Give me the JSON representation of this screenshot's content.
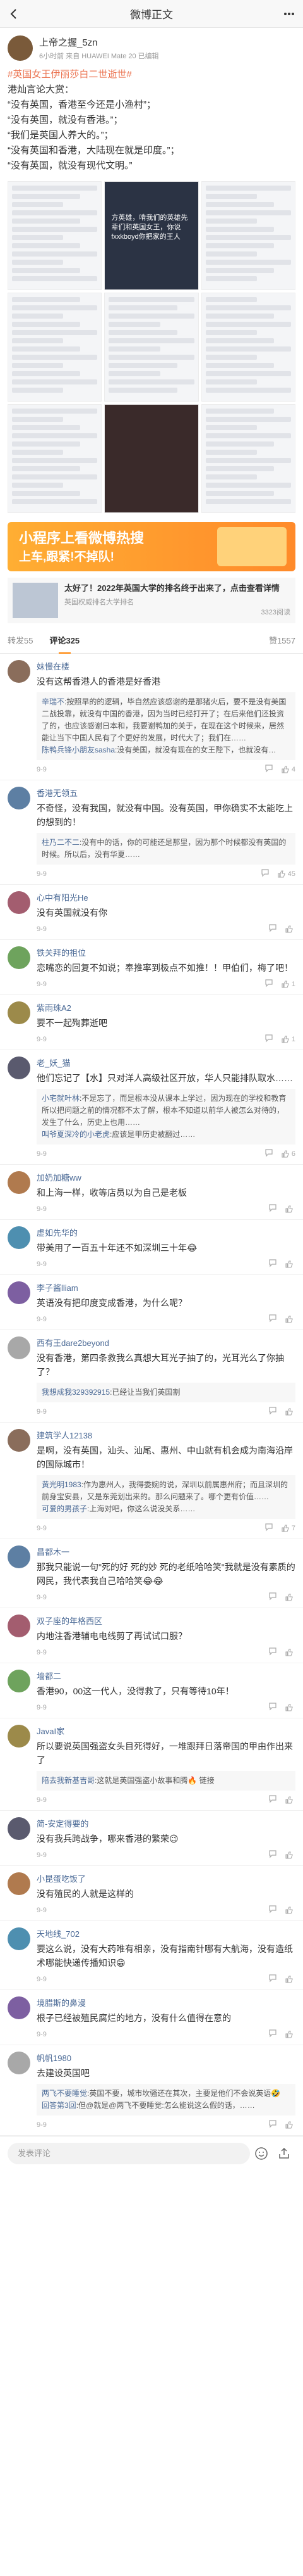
{
  "topbar": {
    "title": "微博正文"
  },
  "post": {
    "author": "上帝之握_5zn",
    "meta": "6小时前 来自 HUAWEI Mate 20 已编辑",
    "tag": "#英国女王伊丽莎白二世逝世#",
    "lines": [
      "港灿言论大赏：",
      "“没有英国，香港至今还是小渔村”；",
      "“没有英国，就没有香港。”；",
      "“我们是英国人养大的。”；",
      "“没有英国和香港，大陆现在就是印度。”；",
      "“没有英国，就没有现代文明。”"
    ],
    "image_caption": "方英雄，啃我们的英雄先辈们和英国女王，你说fxxkboyd你把家的王人"
  },
  "banner": {
    "line1": "小程序上看微博热搜",
    "line2": "上车,跟紧!不掉队!"
  },
  "card": {
    "title": "太好了！2022年英国大学的排名终于出来了，点击查看详情",
    "sub": "英国权威排名大学排名",
    "reads": "3323阅读"
  },
  "tabs": {
    "share": "转发55",
    "comments": "评论325",
    "likes": "赞1557"
  },
  "comments": [
    {
      "name": "妹慢在楼",
      "text": "没有这帮香港人的香港是好香港",
      "reply": {
        "who": "辛瑞不",
        "text": ":按照早的的逻辑，毕自然应该感谢的是那猪火后，要不是没有美国二战投靠，就没有中国的香港，因为当时已经打开了；在后来他们还投资了的，也应该感谢日本和，我要谢鸭加的关于，在现在这个时候来，居然能让当下中国人民有了个更好的发展，时代大了；我们在……",
        "who2": "陈鸭兵锋小朋友sasha",
        "text2": ":没有美国，就没有现在的女王陛下，也就没有…"
      },
      "date": "9-9",
      "likes": "4"
    },
    {
      "name": "香港无领五",
      "text": "不奇怪，没有我国，就没有中国。没有英国，甲你确实不太能吃上的想到的！",
      "reply": {
        "who": "柱乃二不二",
        "text": ":没有中的话，你的可能还是那里，因为那个时候都没有英国的时候。所以后，没有华夏……",
        "who2": "",
        "text2": ""
      },
      "date": "9-9",
      "likes": "45"
    },
    {
      "name": "心中有阳光He",
      "text": "没有英国就没有你",
      "reply": null,
      "date": "9-9",
      "likes": ""
    },
    {
      "name": "铁关拜的祖位",
      "text": "恋嘴恋的回复不如说；奉推率到极点不如推！！甲伯们，梅了吧！",
      "reply": null,
      "date": "9-9",
      "likes": "1"
    },
    {
      "name": "紫雨珠A2",
      "text": "要不一起殉葬逝吧",
      "reply": null,
      "date": "9-9",
      "likes": "1"
    },
    {
      "name": "老_妖_猫",
      "text": "他们忘记了【水】只对洋人高级社区开放，华人只能排队取水……",
      "reply": {
        "who": "小宅就叶林",
        "text": ":不是忘了，而是根本没从课本上学过，因为现在的学校和教育所以把问题之前的情况都不太了解，根本不知道以前华人被怎么对待的，发生了什么，历史上也用……",
        "who2": "叫爷夏深冷的小老虎",
        "text2": ":应该是甲历史被翻过……"
      },
      "date": "9-9",
      "likes": "6"
    },
    {
      "name": "加奶加糖ww",
      "text": "和上海一样，收等店员以为自己是老板",
      "reply": null,
      "date": "9-9",
      "likes": ""
    },
    {
      "name": "虚如先华的",
      "text": "带美用了一百五十年还不如深圳三十年😂",
      "reply": null,
      "date": "9-9",
      "likes": ""
    },
    {
      "name": "李子酱lliam",
      "text": "英语没有把印度变成香港，为什么呢？",
      "reply": null,
      "date": "9-9",
      "likes": ""
    },
    {
      "name": "西有王dare2beyond",
      "text": "没有香港，第四条救我么真想大耳光子抽了的，光耳光么了你抽了？",
      "reply": {
        "who": "我想成我329392915",
        "text": ":已经让当我们英国割",
        "who2": "",
        "text2": ""
      },
      "date": "9-9",
      "likes": ""
    },
    {
      "name": "建筑学人12138",
      "text": "是啊，没有英国，汕头、汕尾、惠州、中山就有机会成为南海沿岸的国际城市！",
      "reply": {
        "who": "黄光明1983",
        "text": ":作为惠州人，我得委婉的说，深圳以前属惠州府；而且深圳的前身宝安县，又是东莞划出来的。那么问题来了。哪个更有价值……",
        "who2": "可爱的男孩子",
        "text2": ":上海对吧，你这么说没关系……"
      },
      "date": "9-9",
      "likes": "7"
    },
    {
      "name": "昌都木一",
      "text": "那我只能说一句\"死的好 死的妙 死的老纸哈哈笑\"我就是没有素质的网民，我代表我自己哈哈笑😂😂",
      "reply": null,
      "date": "9-9",
      "likes": ""
    },
    {
      "name": "双子座的年格西区",
      "text": "内地注香港辅电电线剪了再试试口服？",
      "reply": null,
      "date": "9-9",
      "likes": ""
    },
    {
      "name": "墙都二",
      "text": "香港90，00这一代人，没得救了，只有等待10年！",
      "reply": null,
      "date": "9-9",
      "likes": ""
    },
    {
      "name": "JavaI家",
      "text": "所以要说英国强盗女头目死得好，一堆跟拜日落帝国的甲由作出来了",
      "reply": {
        "who": "陪去我新基吉哥",
        "text": ":这就是英国强盗小故事和腾🔥 链接",
        "who2": "",
        "text2": ""
      },
      "date": "9-9",
      "likes": ""
    },
    {
      "name": "简-安定得要的",
      "text": "没有我兵跨战争，哪来香港的繁荣😉",
      "reply": null,
      "date": "9-9",
      "likes": ""
    },
    {
      "name": "小昆蛋吃饭了",
      "text": "没有殖民的人就是这样的",
      "reply": null,
      "date": "9-9",
      "likes": ""
    },
    {
      "name": "天地线_702",
      "text": "要这么说，没有大药唯有相亲，没有指南针哪有大航海，没有造纸术哪能快递传播知识😁",
      "reply": null,
      "date": "9-9",
      "likes": ""
    },
    {
      "name": "境腊斯的鼻漫",
      "text": "根子已经被殖民腐烂的地方，没有什么值得在意的",
      "reply": null,
      "date": "9-9",
      "likes": ""
    },
    {
      "name": "帆帆1980",
      "text": "去建设英国吧",
      "reply": {
        "who": "两飞不要睡觉",
        "text": ":英国不要，城市坎骚还在其次，主要是他们不会说英语🤣",
        "who2": "回答第3回",
        "text2": ":但@就是@两飞不要睡觉:怎么能说这么假的话，……"
      },
      "date": "9-9",
      "likes": ""
    }
  ],
  "bottom": {
    "placeholder": "发表评论"
  }
}
